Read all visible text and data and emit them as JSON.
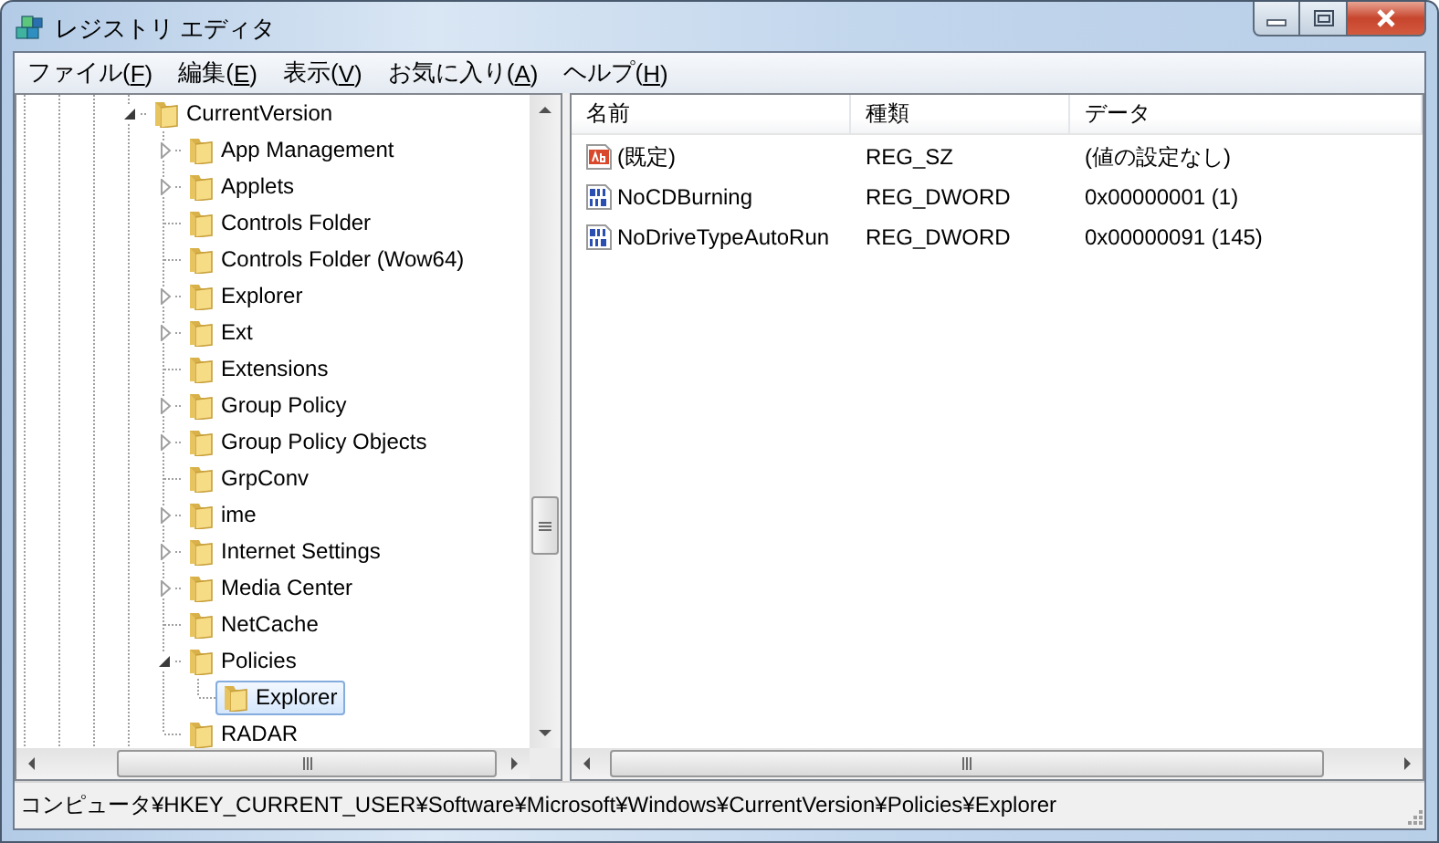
{
  "window": {
    "title": "レジストリ エディタ"
  },
  "menu": [
    {
      "before": "ファイル(",
      "accel": "F",
      "after": ")"
    },
    {
      "before": "編集(",
      "accel": "E",
      "after": ")"
    },
    {
      "before": "表示(",
      "accel": "V",
      "after": ")"
    },
    {
      "before": "お気に入り(",
      "accel": "A",
      "after": ")"
    },
    {
      "before": "ヘルプ(",
      "accel": "H",
      "after": ")"
    }
  ],
  "tree": {
    "items": [
      {
        "label": "CurrentVersion",
        "has_children": true,
        "expanded": true,
        "selected": false,
        "children": [
          {
            "label": "App Management",
            "has_children": true,
            "expanded": false,
            "selected": false
          },
          {
            "label": "Applets",
            "has_children": true,
            "expanded": false,
            "selected": false
          },
          {
            "label": "Controls Folder",
            "has_children": false,
            "expanded": false,
            "selected": false
          },
          {
            "label": "Controls Folder (Wow64)",
            "has_children": false,
            "expanded": false,
            "selected": false
          },
          {
            "label": "Explorer",
            "has_children": true,
            "expanded": false,
            "selected": false
          },
          {
            "label": "Ext",
            "has_children": true,
            "expanded": false,
            "selected": false
          },
          {
            "label": "Extensions",
            "has_children": false,
            "expanded": false,
            "selected": false
          },
          {
            "label": "Group Policy",
            "has_children": true,
            "expanded": false,
            "selected": false
          },
          {
            "label": "Group Policy Objects",
            "has_children": true,
            "expanded": false,
            "selected": false
          },
          {
            "label": "GrpConv",
            "has_children": false,
            "expanded": false,
            "selected": false
          },
          {
            "label": "ime",
            "has_children": true,
            "expanded": false,
            "selected": false
          },
          {
            "label": "Internet Settings",
            "has_children": true,
            "expanded": false,
            "selected": false
          },
          {
            "label": "Media Center",
            "has_children": true,
            "expanded": false,
            "selected": false
          },
          {
            "label": "NetCache",
            "has_children": false,
            "expanded": false,
            "selected": false
          },
          {
            "label": "Policies",
            "has_children": true,
            "expanded": true,
            "selected": false,
            "children": [
              {
                "label": "Explorer",
                "has_children": false,
                "expanded": false,
                "selected": true
              }
            ]
          },
          {
            "label": "RADAR",
            "has_children": false,
            "expanded": false,
            "selected": false
          }
        ]
      }
    ]
  },
  "values": {
    "columns": [
      "名前",
      "種類",
      "データ"
    ],
    "rows": [
      {
        "kind": "string",
        "name": "(既定)",
        "type": "REG_SZ",
        "data": "(値の設定なし)"
      },
      {
        "kind": "dword",
        "name": "NoCDBurning",
        "type": "REG_DWORD",
        "data": "0x00000001 (1)"
      },
      {
        "kind": "dword",
        "name": "NoDriveTypeAutoRun",
        "type": "REG_DWORD",
        "data": "0x00000091 (145)"
      }
    ]
  },
  "status_bar": "コンピュータ¥HKEY_CURRENT_USER¥Software¥Microsoft¥Windows¥CurrentVersion¥Policies¥Explorer"
}
